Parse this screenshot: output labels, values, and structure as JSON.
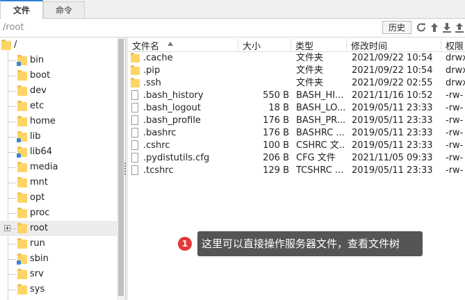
{
  "tabs": [
    {
      "label": "文件",
      "active": true
    },
    {
      "label": "命令",
      "active": false
    }
  ],
  "pathbar": {
    "path": "/root",
    "history_label": "历史",
    "icons": [
      "refresh-icon",
      "up-arrow-icon",
      "download-icon",
      "upload-icon"
    ]
  },
  "tree": {
    "root_label": "/",
    "items": [
      {
        "label": "bin",
        "symlink": true
      },
      {
        "label": "boot",
        "symlink": false
      },
      {
        "label": "dev",
        "symlink": false
      },
      {
        "label": "etc",
        "symlink": false
      },
      {
        "label": "home",
        "symlink": false
      },
      {
        "label": "lib",
        "symlink": true
      },
      {
        "label": "lib64",
        "symlink": true
      },
      {
        "label": "media",
        "symlink": false
      },
      {
        "label": "mnt",
        "symlink": false
      },
      {
        "label": "opt",
        "symlink": false
      },
      {
        "label": "proc",
        "symlink": false
      },
      {
        "label": "root",
        "symlink": false,
        "selected": true,
        "expandable": true
      },
      {
        "label": "run",
        "symlink": false
      },
      {
        "label": "sbin",
        "symlink": true
      },
      {
        "label": "srv",
        "symlink": false
      },
      {
        "label": "sys",
        "symlink": false
      }
    ]
  },
  "filelist": {
    "columns": {
      "name": "文件名",
      "size": "大小",
      "type": "类型",
      "modified": "修改时间",
      "perm": "权限"
    },
    "rows": [
      {
        "name": ".cache",
        "size": "",
        "type": "文件夹",
        "modified": "2021/09/22 10:54",
        "perm": "drwx",
        "kind": "folder"
      },
      {
        "name": ".pip",
        "size": "",
        "type": "文件夹",
        "modified": "2021/09/22 10:54",
        "perm": "drwx",
        "kind": "folder"
      },
      {
        "name": ".ssh",
        "size": "",
        "type": "文件夹",
        "modified": "2021/09/22 02:55",
        "perm": "drwx",
        "kind": "folder"
      },
      {
        "name": ".bash_history",
        "size": "550 B",
        "type": "BASH_HI...",
        "modified": "2021/11/16 10:52",
        "perm": "-rw-",
        "kind": "file"
      },
      {
        "name": ".bash_logout",
        "size": "18 B",
        "type": "BASH_LO...",
        "modified": "2019/05/11 23:33",
        "perm": "-rw-",
        "kind": "file"
      },
      {
        "name": ".bash_profile",
        "size": "176 B",
        "type": "BASH_PR...",
        "modified": "2019/05/11 23:33",
        "perm": "-rw-",
        "kind": "file"
      },
      {
        "name": ".bashrc",
        "size": "176 B",
        "type": "BASHRC ...",
        "modified": "2019/05/11 23:33",
        "perm": "-rw-",
        "kind": "file"
      },
      {
        "name": ".cshrc",
        "size": "100 B",
        "type": "CSHRC 文...",
        "modified": "2019/05/11 23:33",
        "perm": "-rw-",
        "kind": "file"
      },
      {
        "name": ".pydistutils.cfg",
        "size": "206 B",
        "type": "CFG 文件",
        "modified": "2021/11/05 09:33",
        "perm": "-rw-",
        "kind": "file"
      },
      {
        "name": ".tcshrc",
        "size": "129 B",
        "type": "TCSHRC ...",
        "modified": "2019/05/11 23:33",
        "perm": "-rw-",
        "kind": "file"
      }
    ]
  },
  "callout": {
    "number": "1",
    "text": "这里可以直接操作服务器文件，查看文件树"
  },
  "colors": {
    "accent": "#2f7fd7",
    "folder": "#fdd466",
    "badge": "#e53935",
    "callout_bg": "#555555"
  }
}
